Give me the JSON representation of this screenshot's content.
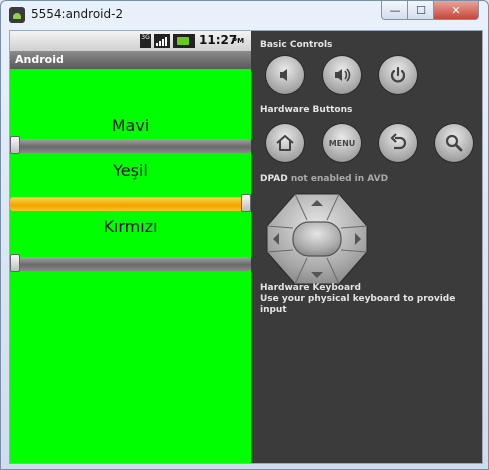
{
  "window": {
    "title": "5554:android-2",
    "min_glyph": "—",
    "max_glyph": "☐",
    "close_glyph": "✕"
  },
  "statusbar": {
    "network": "3G",
    "time": "11:27",
    "ampm": "PM"
  },
  "app": {
    "title": "Android"
  },
  "sliders": [
    {
      "label": "Mavi",
      "value": 0.0
    },
    {
      "label": "Yeşil",
      "value": 1.0
    },
    {
      "label": "Kırmızı",
      "value": 0.0
    }
  ],
  "controls": {
    "basic_heading": "Basic Controls",
    "hardware_heading": "Hardware Buttons",
    "menu_label": "MENU",
    "dpad_heading_a": "DPAD",
    "dpad_heading_b": "not enabled in AVD",
    "keyboard_heading": "Hardware Keyboard",
    "keyboard_note": "Use your physical keyboard to provide input"
  },
  "colors": {
    "screen_bg": "#00ff00",
    "slider_fill": "#f1a400",
    "panel_bg": "#3b3b3b"
  }
}
